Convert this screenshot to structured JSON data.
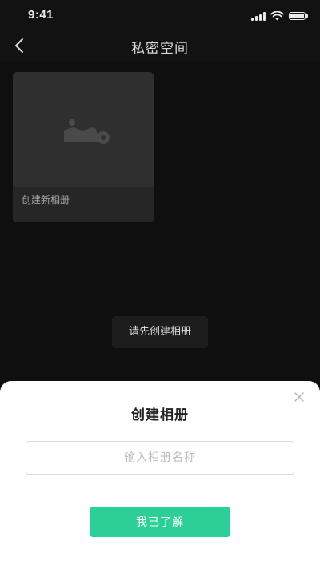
{
  "status_bar": {
    "time": "9:41",
    "icons": [
      "signal-icon",
      "wifi-icon",
      "battery-icon"
    ]
  },
  "nav": {
    "title": "私密空间",
    "back_icon": "chevron-left-icon"
  },
  "album": {
    "label": "创建新相册",
    "icon": "image-placeholder-icon"
  },
  "toast": {
    "text": "请先创建相册"
  },
  "sheet": {
    "title": "创建相册",
    "close_icon": "close-icon",
    "input": {
      "value": "",
      "placeholder": "输入相册名称"
    },
    "confirm_label": "我已了解"
  },
  "colors": {
    "background": "#0f0f0f",
    "accent": "#2ccf95",
    "card": "#262626"
  }
}
